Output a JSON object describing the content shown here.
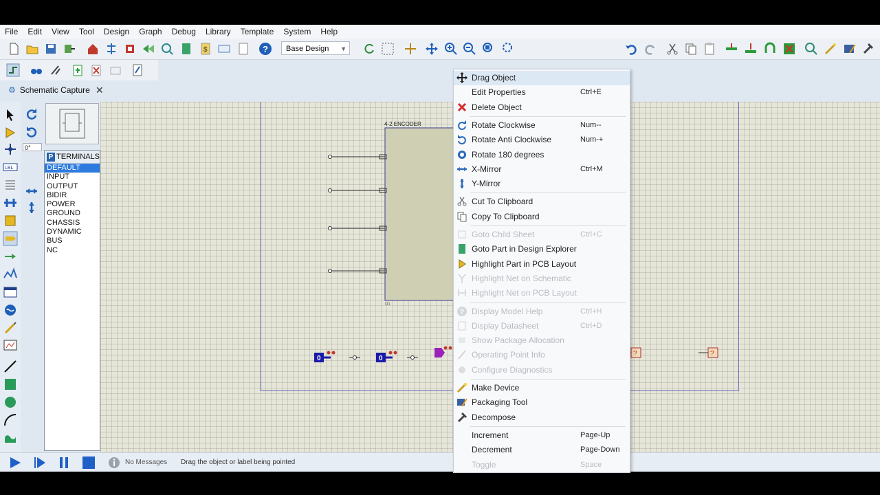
{
  "menu": [
    "File",
    "Edit",
    "View",
    "Tool",
    "Design",
    "Graph",
    "Debug",
    "Library",
    "Template",
    "System",
    "Help"
  ],
  "toolbar": {
    "design_select": "Base Design"
  },
  "tab": {
    "label": "Schematic Capture"
  },
  "angle": "0°",
  "terminals": {
    "header": "TERMINALS",
    "items": [
      "DEFAULT",
      "INPUT",
      "OUTPUT",
      "BIDIR",
      "POWER",
      "GROUND",
      "CHASSIS",
      "DYNAMIC",
      "BUS",
      "NC"
    ],
    "selected": "DEFAULT"
  },
  "schematic": {
    "component_label": "4-2 ENCODER",
    "component_ref": "U1",
    "logic_value": "0"
  },
  "context_menu": [
    {
      "label": "Drag Object",
      "shortcut": "",
      "icon": "drag-icon",
      "disabled": false,
      "group": 0
    },
    {
      "label": "Edit Properties",
      "shortcut": "Ctrl+E",
      "icon": "",
      "disabled": false,
      "group": 0
    },
    {
      "label": "Delete Object",
      "shortcut": "",
      "icon": "delete-icon",
      "disabled": false,
      "group": 0
    },
    {
      "label": "Rotate Clockwise",
      "shortcut": "Num--",
      "icon": "rotate-cw-icon",
      "disabled": false,
      "group": 1
    },
    {
      "label": "Rotate Anti Clockwise",
      "shortcut": "Num-+",
      "icon": "rotate-ccw-icon",
      "disabled": false,
      "group": 1
    },
    {
      "label": "Rotate 180 degrees",
      "shortcut": "",
      "icon": "rotate-180-icon",
      "disabled": false,
      "group": 1
    },
    {
      "label": "X-Mirror",
      "shortcut": "Ctrl+M",
      "icon": "x-mirror-icon",
      "disabled": false,
      "group": 1
    },
    {
      "label": "Y-Mirror",
      "shortcut": "",
      "icon": "y-mirror-icon",
      "disabled": false,
      "group": 1
    },
    {
      "label": "Cut To Clipboard",
      "shortcut": "",
      "icon": "cut-icon",
      "disabled": false,
      "group": 2
    },
    {
      "label": "Copy To Clipboard",
      "shortcut": "",
      "icon": "copy-icon",
      "disabled": false,
      "group": 2
    },
    {
      "label": "Goto Child Sheet",
      "shortcut": "Ctrl+C",
      "icon": "child-sheet-icon",
      "disabled": true,
      "group": 3
    },
    {
      "label": "Goto Part in Design Explorer",
      "shortcut": "",
      "icon": "design-explorer-icon",
      "disabled": false,
      "group": 3
    },
    {
      "label": "Highlight Part in PCB Layout",
      "shortcut": "",
      "icon": "pcb-highlight-icon",
      "disabled": false,
      "group": 3
    },
    {
      "label": "Highlight Net on Schematic",
      "shortcut": "",
      "icon": "net-schematic-icon",
      "disabled": true,
      "group": 3
    },
    {
      "label": "Highlight Net on PCB Layout",
      "shortcut": "",
      "icon": "net-pcb-icon",
      "disabled": true,
      "group": 3
    },
    {
      "label": "Display Model Help",
      "shortcut": "Ctrl+H",
      "icon": "help-icon",
      "disabled": true,
      "group": 4
    },
    {
      "label": "Display Datasheet",
      "shortcut": "Ctrl+D",
      "icon": "datasheet-icon",
      "disabled": true,
      "group": 4
    },
    {
      "label": "Show Package Allocation",
      "shortcut": "",
      "icon": "package-icon",
      "disabled": true,
      "group": 4
    },
    {
      "label": "Operating Point Info",
      "shortcut": "",
      "icon": "probe-icon",
      "disabled": true,
      "group": 4
    },
    {
      "label": "Configure Diagnostics",
      "shortcut": "",
      "icon": "diagnostics-icon",
      "disabled": true,
      "group": 4
    },
    {
      "label": "Make Device",
      "shortcut": "",
      "icon": "make-device-icon",
      "disabled": false,
      "group": 5
    },
    {
      "label": "Packaging Tool",
      "shortcut": "",
      "icon": "packaging-icon",
      "disabled": false,
      "group": 5
    },
    {
      "label": "Decompose",
      "shortcut": "",
      "icon": "hammer-icon",
      "disabled": false,
      "group": 5
    },
    {
      "label": "Increment",
      "shortcut": "Page-Up",
      "icon": "",
      "disabled": false,
      "group": 6
    },
    {
      "label": "Decrement",
      "shortcut": "Page-Down",
      "icon": "",
      "disabled": false,
      "group": 6
    },
    {
      "label": "Toggle",
      "shortcut": "Space",
      "icon": "",
      "disabled": true,
      "group": 6
    }
  ],
  "status": {
    "messages": "No Messages",
    "hint": "Drag the object or label being pointed"
  },
  "colors": {
    "accent": "#2e7be0",
    "sheet_border": "#6a6abd",
    "component_fill": "#cfcfb4",
    "logic_probe": "#1a1aa8"
  }
}
